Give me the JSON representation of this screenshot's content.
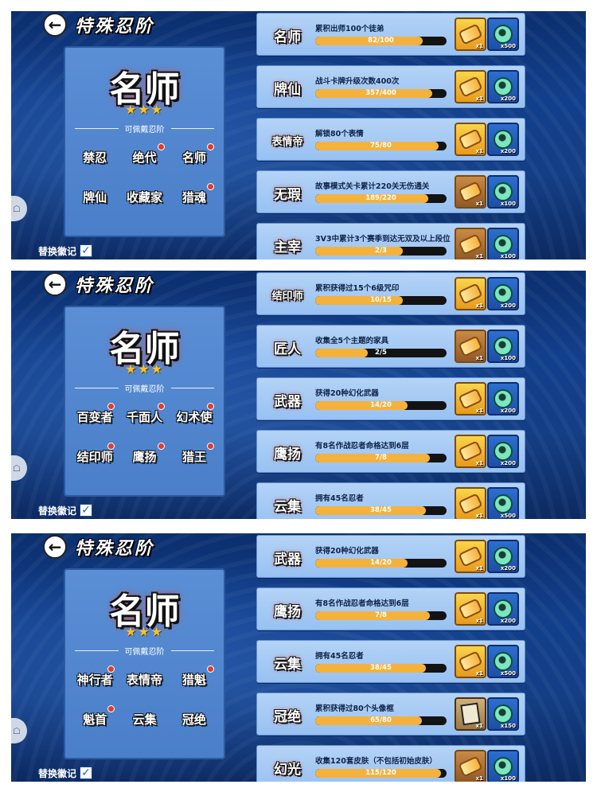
{
  "header": {
    "title": "特殊忍阶",
    "back_glyph": "←"
  },
  "current_rank": {
    "name": "名师",
    "stars": "★★★"
  },
  "wearable_label": "可佩戴忍阶",
  "replace_label": "替换徽记",
  "check_glyph": "✓",
  "side_tab_glyph": "☖",
  "colors": {
    "progress_fill": "#f4b23d",
    "progress_track": "#131313",
    "row_bg": "#a8cbf4",
    "card_bg": "#4f86cf",
    "badge_dot": "#e23b2b"
  },
  "panels": [
    {
      "badges": [
        {
          "name": "禁忍",
          "dot": false
        },
        {
          "name": "绝代",
          "dot": true
        },
        {
          "name": "名师",
          "dot": true
        },
        {
          "name": "牌仙",
          "dot": false
        },
        {
          "name": "收藏家",
          "dot": false
        },
        {
          "name": "猎魂",
          "dot": true
        }
      ],
      "tasks": [
        {
          "badge": "名师",
          "desc": "累积出师100个徒弟",
          "progress": "82/100",
          "ratio": 0.82,
          "reward1": "x1",
          "reward1_type": "scroll",
          "reward2": "x500"
        },
        {
          "badge": "牌仙",
          "desc": "战斗卡牌升级次数400次",
          "progress": "357/400",
          "ratio": 0.8925,
          "reward1": "x1",
          "reward1_type": "scroll",
          "reward2": "x200"
        },
        {
          "badge": "表情帝",
          "desc": "解锁80个表情",
          "progress": "75/80",
          "ratio": 0.9375,
          "reward1": "x1",
          "reward1_type": "scroll",
          "reward2": "x200"
        },
        {
          "badge": "无瑕",
          "desc": "故事模式关卡累计220关无伤通关",
          "progress": "189/220",
          "ratio": 0.859,
          "reward1": "x1",
          "reward1_type": "scroll-alt",
          "reward2": "x100"
        },
        {
          "badge": "主宰",
          "desc": "3V3中累计3个赛季到达无双及以上段位",
          "progress": "2/3",
          "ratio": 0.667,
          "reward1": "x1",
          "reward1_type": "scroll-alt",
          "reward2": "x100"
        }
      ]
    },
    {
      "badges": [
        {
          "name": "百变者",
          "dot": true
        },
        {
          "name": "千面人",
          "dot": true
        },
        {
          "name": "幻术使",
          "dot": true
        },
        {
          "name": "结印师",
          "dot": true
        },
        {
          "name": "鹰扬",
          "dot": true
        },
        {
          "name": "猎王",
          "dot": true
        }
      ],
      "tasks": [
        {
          "badge": "结印师",
          "desc": "累积获得过15个6级咒印",
          "progress": "10/15",
          "ratio": 0.667,
          "reward1": "x1",
          "reward1_type": "scroll",
          "reward2": "x200"
        },
        {
          "badge": "匠人",
          "desc": "收集全5个主题的家具",
          "progress": "2/5",
          "ratio": 0.4,
          "reward1": "x1",
          "reward1_type": "scroll-alt",
          "reward2": "x100"
        },
        {
          "badge": "武器",
          "desc": "获得20种幻化武器",
          "progress": "14/20",
          "ratio": 0.7,
          "reward1": "x1",
          "reward1_type": "scroll",
          "reward2": "x200"
        },
        {
          "badge": "鹰扬",
          "desc": "有8名作战忍者命格达到6层",
          "progress": "7/8",
          "ratio": 0.875,
          "reward1": "x1",
          "reward1_type": "scroll",
          "reward2": "x200"
        },
        {
          "badge": "云集",
          "desc": "拥有45名忍者",
          "progress": "38/45",
          "ratio": 0.844,
          "reward1": "x1",
          "reward1_type": "scroll",
          "reward2": "x500"
        }
      ]
    },
    {
      "badges": [
        {
          "name": "神行者",
          "dot": true
        },
        {
          "name": "表情帝",
          "dot": false
        },
        {
          "name": "猎魁",
          "dot": true
        },
        {
          "name": "魁首",
          "dot": true
        },
        {
          "name": "云集",
          "dot": false
        },
        {
          "name": "冠绝",
          "dot": false
        }
      ],
      "tasks": [
        {
          "badge": "武器",
          "desc": "获得20种幻化武器",
          "progress": "14/20",
          "ratio": 0.7,
          "reward1": "x1",
          "reward1_type": "scroll",
          "reward2": "x200"
        },
        {
          "badge": "鹰扬",
          "desc": "有8名作战忍者命格达到6层",
          "progress": "7/8",
          "ratio": 0.875,
          "reward1": "x1",
          "reward1_type": "scroll",
          "reward2": "x200"
        },
        {
          "badge": "云集",
          "desc": "拥有45名忍者",
          "progress": "38/45",
          "ratio": 0.844,
          "reward1": "x1",
          "reward1_type": "scroll",
          "reward2": "x500"
        },
        {
          "badge": "冠绝",
          "desc": "累积获得过80个头像框",
          "progress": "65/80",
          "ratio": 0.8125,
          "reward1": "x1",
          "reward1_type": "card",
          "reward2": "x150"
        },
        {
          "badge": "幻光",
          "desc": "收集120套皮肤（不包括初始皮肤）",
          "progress": "115/120",
          "ratio": 0.958,
          "reward1": "x1",
          "reward1_type": "scroll-alt",
          "reward2": "x100"
        }
      ]
    }
  ]
}
